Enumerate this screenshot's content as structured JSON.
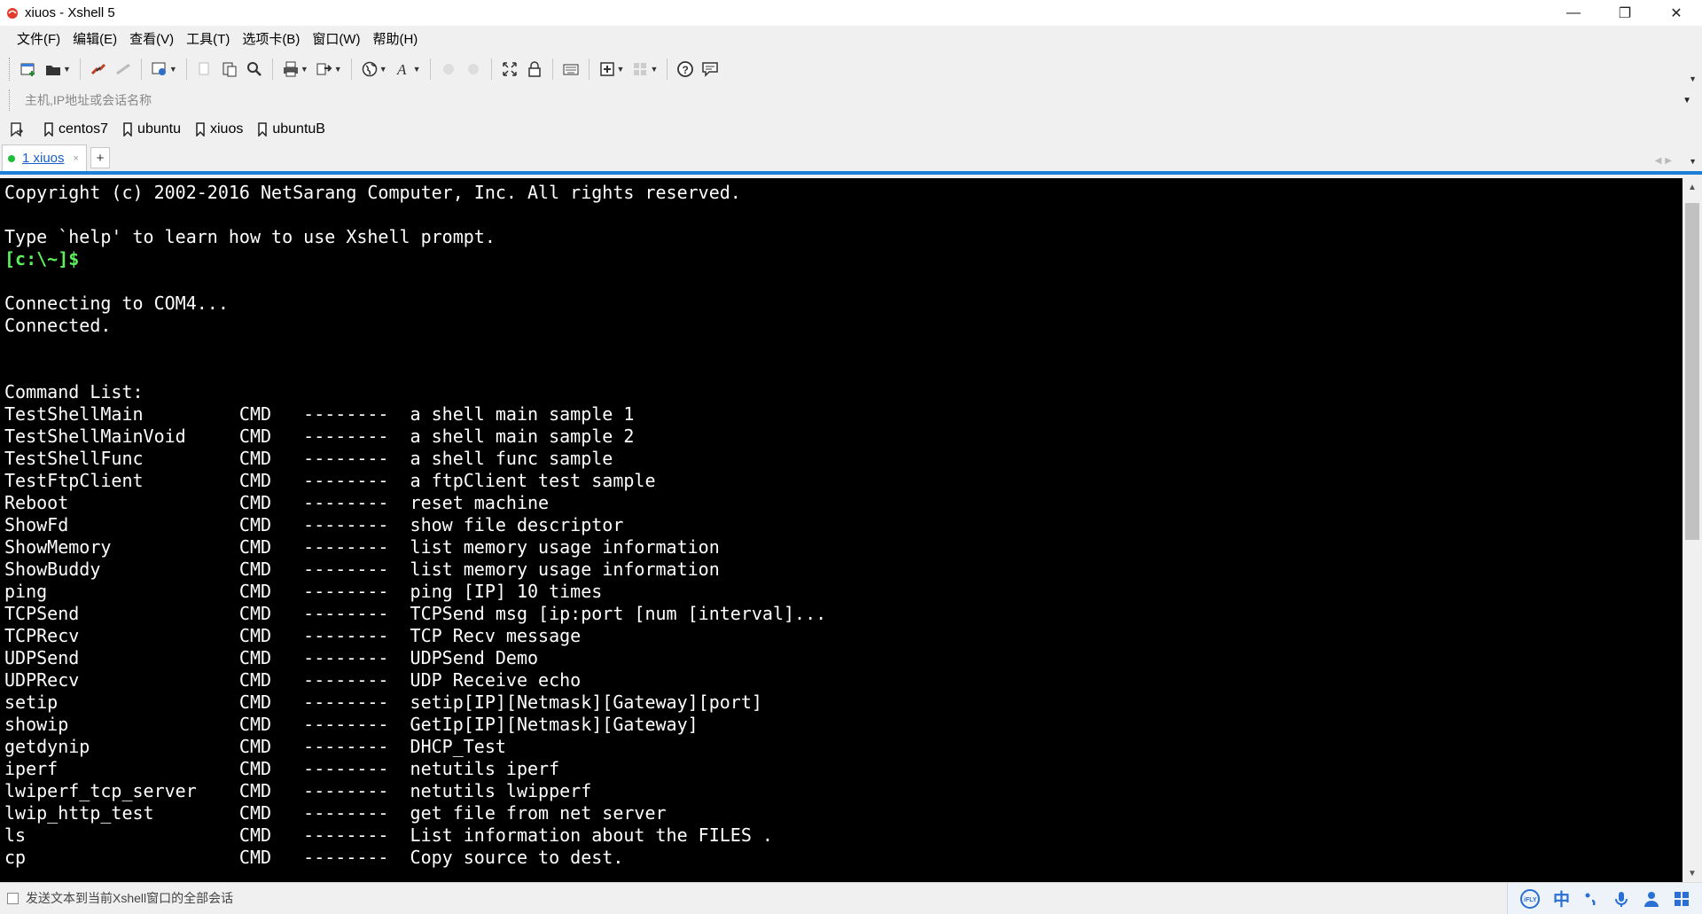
{
  "window": {
    "title": "xiuos - Xshell 5",
    "minimize": "—",
    "maximize": "❐",
    "close": "✕"
  },
  "menu": [
    "文件(F)",
    "编辑(E)",
    "查看(V)",
    "工具(T)",
    "选项卡(B)",
    "窗口(W)",
    "帮助(H)"
  ],
  "toolbar": {
    "icons": [
      "new-session-icon",
      "open-folder-icon",
      "reconnect-icon",
      "disconnect-icon",
      "properties-icon",
      "copy-icon",
      "paste-icon",
      "find-icon",
      "print-icon",
      "transfer-icon",
      "globe-icon",
      "font-icon",
      "back-icon",
      "forward-icon",
      "fullscreen-icon",
      "lock-icon",
      "keyboard-icon",
      "compose-icon",
      "tile-icon",
      "help-icon",
      "chat-icon"
    ]
  },
  "address": {
    "placeholder": "主机,IP地址或会话名称"
  },
  "links": [
    "centos7",
    "ubuntu",
    "xiuos",
    "ubuntuB"
  ],
  "tabs": [
    {
      "label": "1 xiuos",
      "close": "×"
    }
  ],
  "tab_add": "+",
  "terminal": {
    "lines": [
      {
        "text": "Copyright (c) 2002-2016 NetSarang Computer, Inc. All rights reserved.",
        "type": "normal"
      },
      {
        "text": "",
        "type": "normal"
      },
      {
        "text": "Type `help' to learn how to use Xshell prompt.",
        "type": "normal"
      },
      {
        "text": "[c:\\~]$",
        "type": "prompt"
      },
      {
        "text": "",
        "type": "normal"
      },
      {
        "text": "Connecting to COM4...",
        "type": "normal"
      },
      {
        "text": "Connected.",
        "type": "normal"
      },
      {
        "text": "",
        "type": "normal"
      },
      {
        "text": "",
        "type": "normal"
      },
      {
        "text": "Command List:",
        "type": "normal"
      },
      {
        "text": "TestShellMain         CMD   --------  a shell main sample 1",
        "type": "normal"
      },
      {
        "text": "TestShellMainVoid     CMD   --------  a shell main sample 2",
        "type": "normal"
      },
      {
        "text": "TestShellFunc         CMD   --------  a shell func sample",
        "type": "normal"
      },
      {
        "text": "TestFtpClient         CMD   --------  a ftpClient test sample",
        "type": "normal"
      },
      {
        "text": "Reboot                CMD   --------  reset machine",
        "type": "normal"
      },
      {
        "text": "ShowFd                CMD   --------  show file descriptor",
        "type": "normal"
      },
      {
        "text": "ShowMemory            CMD   --------  list memory usage information",
        "type": "normal"
      },
      {
        "text": "ShowBuddy             CMD   --------  list memory usage information",
        "type": "normal"
      },
      {
        "text": "ping                  CMD   --------  ping [IP] 10 times",
        "type": "normal"
      },
      {
        "text": "TCPSend               CMD   --------  TCPSend msg [ip:port [num [interval]...",
        "type": "normal"
      },
      {
        "text": "TCPRecv               CMD   --------  TCP Recv message",
        "type": "normal"
      },
      {
        "text": "UDPSend               CMD   --------  UDPSend Demo",
        "type": "normal"
      },
      {
        "text": "UDPRecv               CMD   --------  UDP Receive echo",
        "type": "normal"
      },
      {
        "text": "setip                 CMD   --------  setip[IP][Netmask][Gateway][port]",
        "type": "normal"
      },
      {
        "text": "showip                CMD   --------  GetIp[IP][Netmask][Gateway]",
        "type": "normal"
      },
      {
        "text": "getdynip              CMD   --------  DHCP_Test",
        "type": "normal"
      },
      {
        "text": "iperf                 CMD   --------  netutils iperf",
        "type": "normal"
      },
      {
        "text": "lwiperf_tcp_server    CMD   --------  netutils lwipperf",
        "type": "normal"
      },
      {
        "text": "lwip_http_test        CMD   --------  get file from net server",
        "type": "normal"
      },
      {
        "text": "ls                    CMD   --------  List information about the FILES .",
        "type": "normal"
      },
      {
        "text": "cp                    CMD   --------  Copy source to dest.",
        "type": "normal"
      }
    ]
  },
  "status": {
    "text": "发送文本到当前Xshell窗口的全部会话"
  },
  "ime": [
    "ime-logo-icon",
    "中",
    "punctuation-icon",
    "microphone-icon",
    "user-icon",
    "apps-icon"
  ],
  "colors": {
    "accent": "#1e7fd6",
    "prompt": "#5cf05a",
    "terminal_bg": "#000000",
    "terminal_fg": "#ffffff",
    "tab_active_dot": "#1dbf3a"
  }
}
